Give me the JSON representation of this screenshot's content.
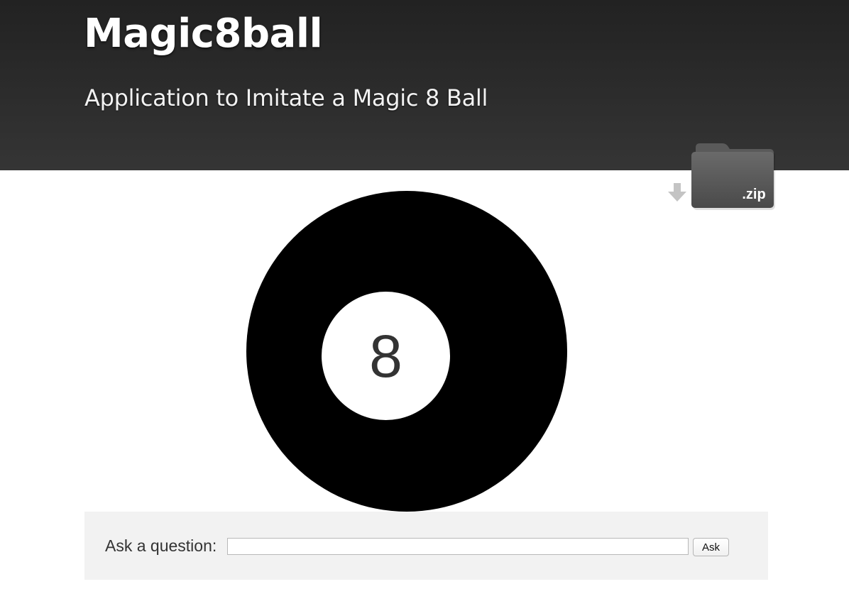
{
  "header": {
    "title": "Magic8ball",
    "subtitle": "Application to Imitate a Magic 8 Ball"
  },
  "download": {
    "label": ".zip",
    "icon": "download-arrow-icon",
    "folder_icon": "zip-folder-icon"
  },
  "ball": {
    "number": "8",
    "ball_color": "#000000",
    "window_color": "#ffffff",
    "number_color": "#333333"
  },
  "question_form": {
    "label": "Ask a question:",
    "input_value": "",
    "button_label": "Ask"
  },
  "colors": {
    "header_background": "#2c2c2c",
    "panel_background": "#f2f2f2",
    "page_background": "#ffffff"
  }
}
